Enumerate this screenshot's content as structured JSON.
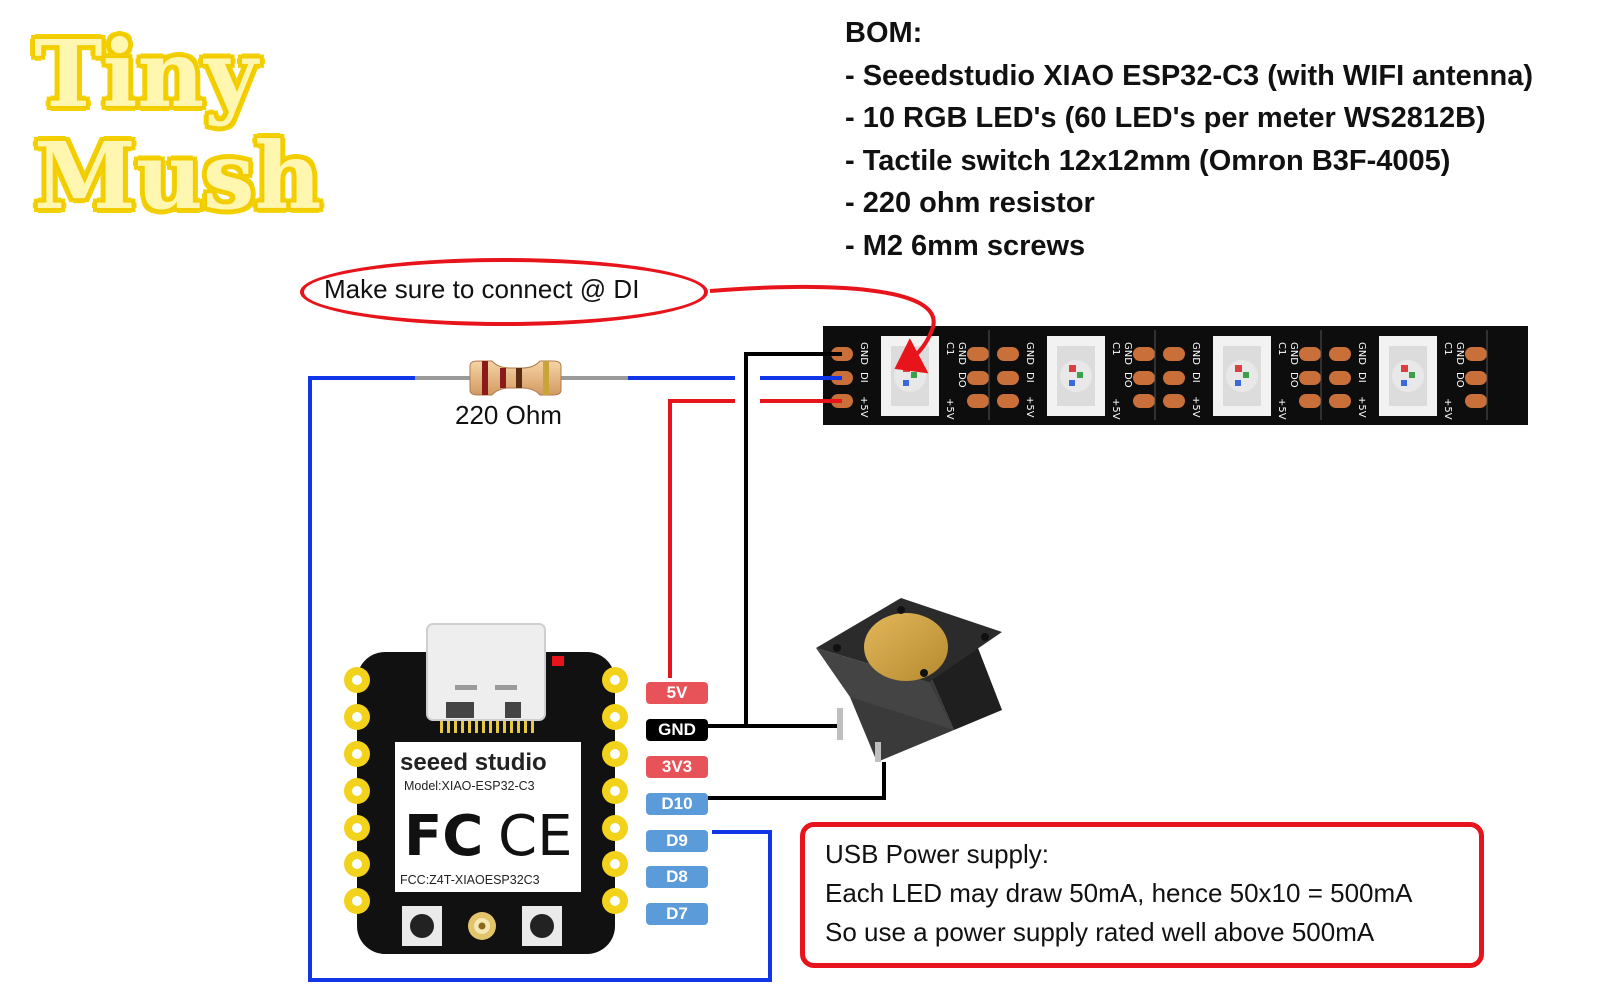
{
  "title": {
    "line1": "Tiny",
    "line2": "Mush"
  },
  "bom": {
    "heading": "BOM:",
    "items": [
      "- Seeedstudio XIAO ESP32-C3 (with WIFI antenna)",
      "- 10 RGB LED's (60 LED's per meter WS2812B)",
      "- Tactile switch 12x12mm (Omron B3F-4005)",
      "- 220 ohm resistor",
      "- M2 6mm screws"
    ]
  },
  "callout": "Make sure to connect @ DI",
  "resistor_label": "220 Ohm",
  "pins": [
    "5V",
    "GND",
    "3V3",
    "D10",
    "D9",
    "D8",
    "D7"
  ],
  "board": {
    "brand": "seeed studio",
    "model": "Model:XIAO-ESP32-C3",
    "fc": "FC",
    "ce": "CE",
    "fcc": "FCC:Z4T-XIAOESP32C3"
  },
  "led_strip": {
    "pad_labels": [
      "GND",
      "DI",
      "+5V",
      "DO",
      "C1"
    ]
  },
  "power_note": [
    "USB Power supply:",
    "Each LED may draw 50mA, hence 50x10 = 500mA",
    "So use a power supply rated well above 500mA"
  ],
  "colors": {
    "wire_red": "#e8141b",
    "wire_blue": "#1036e8",
    "wire_black": "#000000",
    "title_yellow": "#f5d000"
  }
}
